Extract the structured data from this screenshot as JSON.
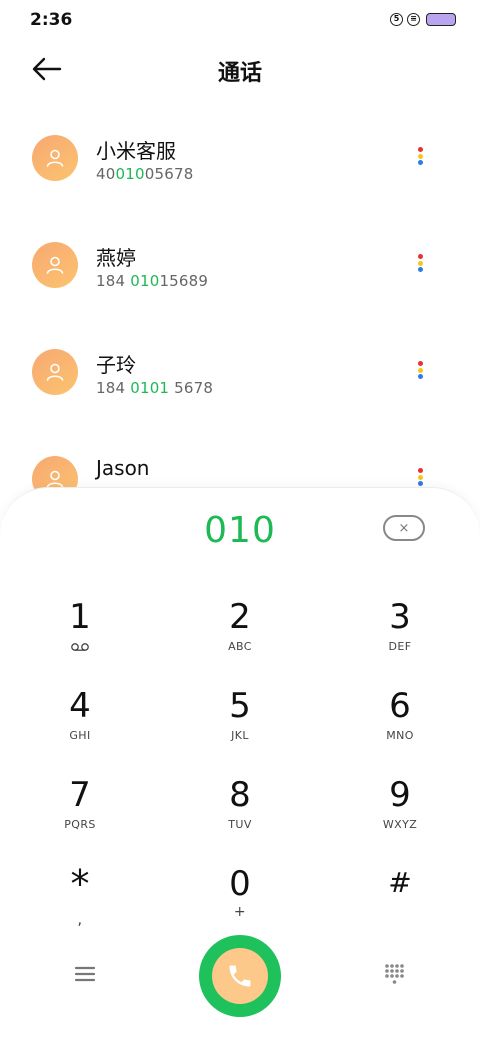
{
  "status_bar": {
    "time": "2:36",
    "icon1": "5",
    "icon2": "≡"
  },
  "header": {
    "title": "通话"
  },
  "contacts": [
    {
      "name": "小米客服",
      "number_before": "40",
      "number_match": "010",
      "number_after": "05678"
    },
    {
      "name": "燕婷",
      "number_before": "184 ",
      "number_match": "010",
      "number_after": "15689"
    },
    {
      "name": "子玲",
      "number_before": "184 ",
      "number_match": "0101",
      "number_after": " 5678"
    },
    {
      "name": "Jason",
      "number_before": "",
      "number_match": "",
      "number_after": ""
    }
  ],
  "dialer": {
    "input_value": "010",
    "backspace_label": "×",
    "keys": [
      {
        "digit": "1",
        "letters": ""
      },
      {
        "digit": "2",
        "letters": "ABC"
      },
      {
        "digit": "3",
        "letters": "DEF"
      },
      {
        "digit": "4",
        "letters": "GHI"
      },
      {
        "digit": "5",
        "letters": "JKL"
      },
      {
        "digit": "6",
        "letters": "MNO"
      },
      {
        "digit": "7",
        "letters": "PQRS"
      },
      {
        "digit": "8",
        "letters": "TUV"
      },
      {
        "digit": "9",
        "letters": "WXYZ"
      },
      {
        "digit": "*",
        "letters": ","
      },
      {
        "digit": "0",
        "letters": "+"
      },
      {
        "digit": "#",
        "letters": ""
      }
    ]
  },
  "colors": {
    "accent_green": "#1db954",
    "call_button": "#1ec15c",
    "avatar_orange": "#f7a972",
    "dot_red": "#e8322e",
    "dot_yellow": "#f5c518",
    "dot_blue": "#2d7be5"
  },
  "icons": {
    "back": "arrow-left-icon",
    "voicemail": "voicemail-icon",
    "menu": "menu-icon",
    "call": "phone-icon",
    "keypad": "dialpad-icon",
    "more": "more-vertical-icon",
    "avatar": "person-icon"
  }
}
